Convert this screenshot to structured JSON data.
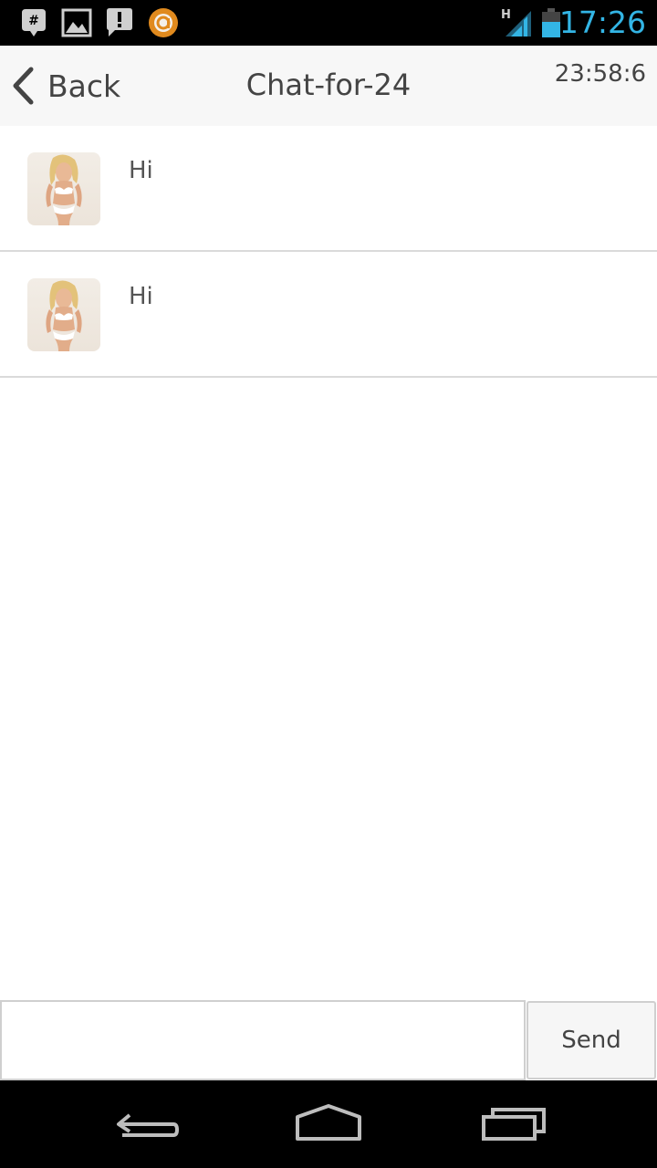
{
  "status_bar": {
    "time": "17:26",
    "network_type": "H",
    "icons": [
      "notification-plus-icon",
      "gallery-icon",
      "alert-icon",
      "orange-app-icon",
      "signal-icon",
      "battery-icon"
    ],
    "accent_color": "#33b5e5"
  },
  "header": {
    "back_label": "Back",
    "title": "Chat-for-24",
    "clock": "23:58:6"
  },
  "messages": [
    {
      "text": "Hi",
      "avatar": "user-avatar"
    },
    {
      "text": "Hi",
      "avatar": "user-avatar"
    }
  ],
  "composer": {
    "input_value": "",
    "input_placeholder": "",
    "send_label": "Send"
  },
  "system_nav": {
    "buttons": [
      "back-icon",
      "home-icon",
      "recent-apps-icon"
    ]
  }
}
